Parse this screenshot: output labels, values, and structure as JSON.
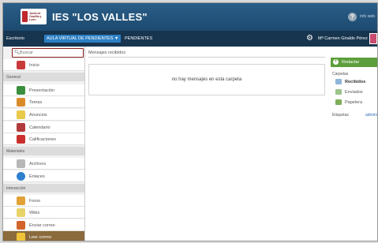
{
  "header": {
    "logo_text_line1": "Junta de",
    "logo_text_line2": "Castilla y León",
    "site_title": "IES \"LOS VALLES\"",
    "help_glyph": "?",
    "info_link": "Info web"
  },
  "navbar": {
    "home": "Escritorio",
    "course": "AULA VIRTUAL DE PENDIENTES",
    "course_caret": "▼",
    "section": "PENDIENTES",
    "user_name": "Mª Carmen Giraldo Pérez"
  },
  "sidebar": {
    "search_placeholder": "Buscar",
    "start": "Inicio",
    "section_general": "General",
    "general_items": [
      "Presentación",
      "Temas",
      "Anuncios",
      "Calendario",
      "Calificaciones"
    ],
    "section_materials": "Materiales",
    "materials_items": [
      "Archivos",
      "Enlaces"
    ],
    "section_interaction": "Interacción",
    "interaction_items": [
      "Foros",
      "Wikis",
      "Enviar correo",
      "Leer correo"
    ]
  },
  "main": {
    "title": "Mensajes recibidos",
    "empty_message": "no hay mensajes en esta carpeta"
  },
  "right": {
    "compose": "Redactar",
    "folders_header": "Carpetas",
    "folders": [
      "Recibidos",
      "Enviados",
      "Papelera"
    ],
    "tags_header": "Etiquetas",
    "admin_link": "administrar"
  },
  "colors": {
    "header_bg": "#1d4a70",
    "navbar_bg": "#17354f",
    "accent_blue": "#2c7fc4",
    "active_row": "#8b6a3c",
    "compose_green": "#5c9e3c"
  }
}
